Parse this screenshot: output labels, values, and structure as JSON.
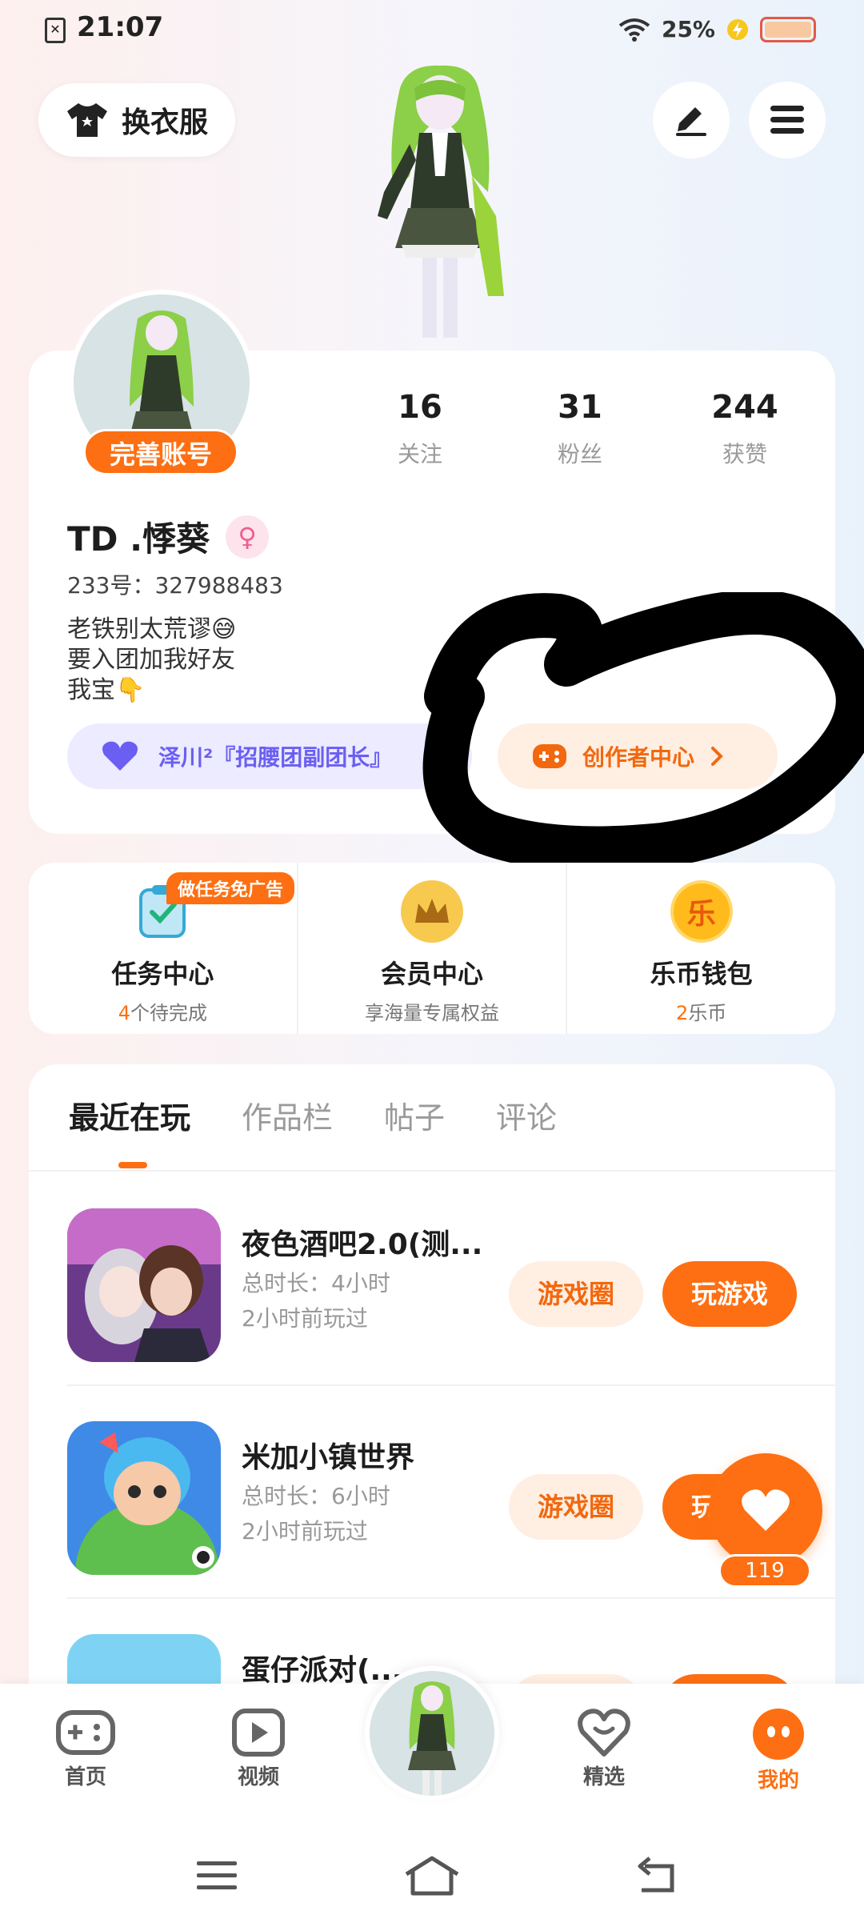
{
  "status_bar": {
    "time": "21:07",
    "battery": "25%"
  },
  "top": {
    "dress_label": "换衣服"
  },
  "profile": {
    "complete_tag": "完善账号",
    "stats": [
      {
        "num": "16",
        "label": "关注"
      },
      {
        "num": "31",
        "label": "粉丝"
      },
      {
        "num": "244",
        "label": "获赞"
      }
    ],
    "name": "TD .悸葵",
    "gender": "♀",
    "uid": "233号：327988483",
    "bio": [
      "老铁别太荒谬😅",
      "要入团加我好友",
      "我宝👇"
    ],
    "group": "泽川²『招腰团副团长』",
    "creator": "创作者中心"
  },
  "services": [
    {
      "title": "任务中心",
      "highlight": "4",
      "sub": "个待完成"
    },
    {
      "title": "会员中心",
      "highlight": "",
      "sub": "享海量专属权益"
    },
    {
      "title": "乐币钱包",
      "highlight": "2",
      "sub": "乐币"
    }
  ],
  "ad_tag": "做任务免广告",
  "wallet_icon": "乐",
  "tabs": [
    "最近在玩",
    "作品栏",
    "帖子",
    "评论"
  ],
  "games": [
    {
      "name": "夜色酒吧2.0(测...",
      "duration": "总时长：4小时",
      "last": "2小时前玩过",
      "circle": "游戏圈",
      "play": "玩游戏"
    },
    {
      "name": "米加小镇世界",
      "duration": "总时长：6小时",
      "last": "2小时前玩过",
      "circle": "游戏圈",
      "play": "玩游戏"
    },
    {
      "name": "蛋仔派对(..."
    }
  ],
  "float": {
    "count": "119"
  },
  "nav": [
    {
      "label": "首页"
    },
    {
      "label": "视频"
    },
    {
      "label": "精选"
    },
    {
      "label": "我的"
    }
  ],
  "colors": {
    "accent": "#fd6f12",
    "purple": "#6a5ff2",
    "pale_orange": "#ffeee2"
  }
}
